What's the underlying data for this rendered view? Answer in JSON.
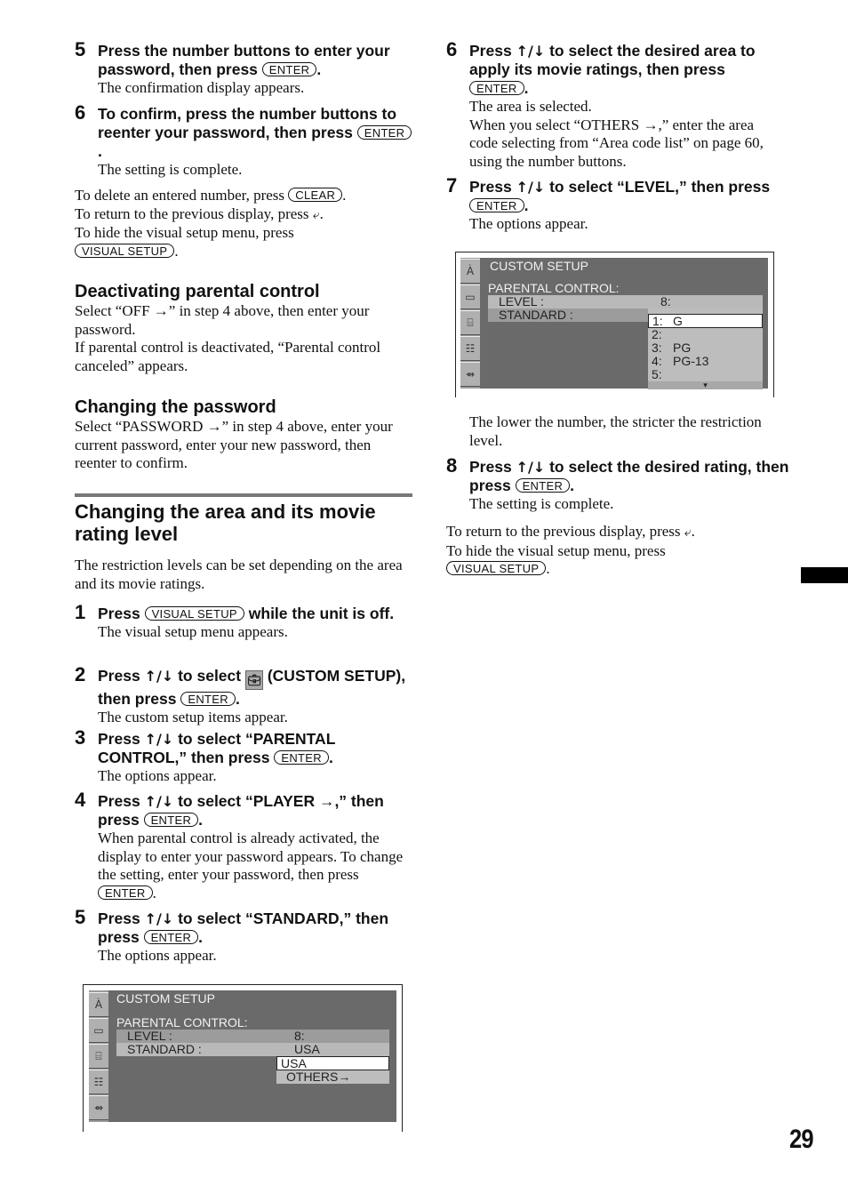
{
  "left_column": {
    "step5a": {
      "num": "5",
      "head_1": "Press the number buttons to enter your password, then press",
      "key": "ENTER",
      "head_end": ".",
      "body": "The confirmation display appears."
    },
    "step6a": {
      "num": "6",
      "head_1": "To confirm, press the number buttons to reenter your password, then press",
      "key": "ENTER",
      "head_end": ".",
      "body": "The setting is complete."
    },
    "notes": {
      "delete_text": "To delete an entered number, press",
      "delete_key": "CLEAR",
      "return_text": "To return to the previous display, press",
      "return_icon": "return-icon",
      "hide_text": "To hide the visual setup menu, press",
      "hide_key": "VISUAL SETUP"
    },
    "deactivating": {
      "title": "Deactivating parental control",
      "body_1": "Select “OFF →” in step 4 above, then enter your password.",
      "body_2": "If parental control is deactivated, “Parental control canceled” appears."
    },
    "changing_password": {
      "title": "Changing the password",
      "body": "Select “PASSWORD →” in step 4 above, enter your current password, enter your new password, then reenter to confirm."
    },
    "section": {
      "title": "Changing the area and its movie rating level",
      "intro": "The restriction levels can be set depending on the area and its movie ratings."
    },
    "step1": {
      "num": "1",
      "head_pre": "Press",
      "key": "VISUAL SETUP",
      "head_post": "while the unit is off.",
      "body": "The visual setup menu appears."
    },
    "step2": {
      "num": "2",
      "head_pre": "Press",
      "arrows": "↑/↓",
      "head_mid": "to select",
      "icon": "toolbox-icon",
      "head_post": "(CUSTOM SETUP), then press",
      "key": "ENTER",
      "head_end": ".",
      "body": "The custom setup items appear."
    },
    "step3": {
      "num": "3",
      "head_pre": "Press",
      "arrows": "↑/↓",
      "head_post": "to select “PARENTAL CONTROL,” then press",
      "key": "ENTER",
      "head_end": ".",
      "body": "The options appear."
    },
    "step4": {
      "num": "4",
      "head_pre": "Press",
      "arrows": "↑/↓",
      "head_post": "to select “PLAYER →,” then press",
      "key": "ENTER",
      "head_end": ".",
      "body_1": "When parental control is already activated, the display to enter your password appears. To change the setting, enter your password, then press",
      "body_key": "ENTER",
      "body_end": "."
    },
    "step5b": {
      "num": "5",
      "head_pre": "Press",
      "arrows": "↑/↓",
      "head_post": "to select “STANDARD,” then press",
      "key": "ENTER",
      "head_end": ".",
      "body": "The options appear."
    },
    "screen": {
      "title": "CUSTOM SETUP",
      "subtitle": "PARENTAL CONTROL:",
      "rows": [
        {
          "label": "LEVEL :",
          "value": "8:"
        },
        {
          "label": "STANDARD :",
          "value": "USA"
        }
      ],
      "dropdown": [
        {
          "label": "USA",
          "selected": true
        },
        {
          "label": "OTHERS→",
          "selected": false
        }
      ],
      "side_icons": [
        "language-icon",
        "screen-icon",
        "toolbox-icon",
        "audio-settings-icon",
        "connection-icon"
      ]
    }
  },
  "right_column": {
    "step6b": {
      "num": "6",
      "head_pre": "Press",
      "arrows": "↑/↓",
      "head_post": "to select the desired area to apply its movie ratings, then press",
      "key": "ENTER",
      "head_end": ".",
      "body_1": "The area is selected.",
      "body_2": "When you select “OTHERS →,” enter the area code selecting from “Area code list” on page 60, using the number buttons."
    },
    "step7": {
      "num": "7",
      "head_pre": "Press",
      "arrows": "↑/↓",
      "head_post": "to select “LEVEL,” then press",
      "key": "ENTER",
      "head_end": ".",
      "body": "The options appear."
    },
    "screen": {
      "title": "CUSTOM SETUP",
      "subtitle": "PARENTAL CONTROL:",
      "rows": [
        {
          "label": "LEVEL :",
          "value": "8:"
        },
        {
          "label": "STANDARD :",
          "value": ""
        }
      ],
      "dropdown": [
        {
          "num": "1:",
          "label": "G",
          "selected": true
        },
        {
          "num": "2:",
          "label": "",
          "selected": false
        },
        {
          "num": "3:",
          "label": "PG",
          "selected": false
        },
        {
          "num": "4:",
          "label": "PG-13",
          "selected": false
        },
        {
          "num": "5:",
          "label": "",
          "selected": false
        }
      ],
      "more_indicator": "▾",
      "side_icons": [
        "language-icon",
        "screen-icon",
        "toolbox-icon",
        "audio-settings-icon",
        "connection-icon"
      ]
    },
    "note": "The lower the number, the stricter the restriction level.",
    "step8": {
      "num": "8",
      "head_pre": "Press",
      "arrows": "↑/↓",
      "head_post": "to select the desired rating, then press",
      "key": "ENTER",
      "head_end": ".",
      "body": "The setting is complete."
    },
    "notes": {
      "return_text": "To return to the previous display, press",
      "hide_text": "To hide the visual setup menu, press",
      "hide_key": "VISUAL SETUP"
    }
  },
  "page_number": "29"
}
